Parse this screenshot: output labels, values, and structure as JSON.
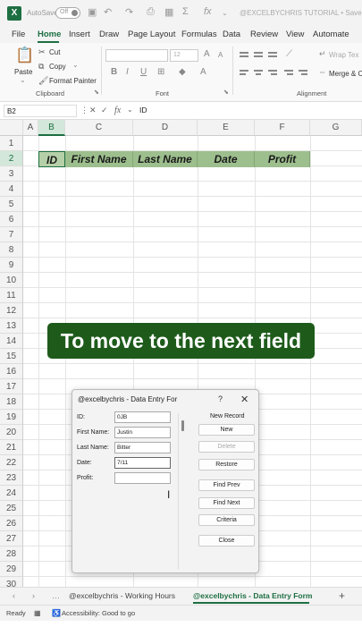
{
  "titlebar": {
    "autosave_label": "AutoSave",
    "toggle_label": "Off",
    "title": "@EXCELBYCHRIS TUTORIAL • Saved",
    "title_chevron": "⌄"
  },
  "menu": {
    "tabs": [
      "File",
      "Home",
      "Insert",
      "Draw",
      "Page Layout",
      "Formulas",
      "Data",
      "Review",
      "View",
      "Automate"
    ],
    "active": "Home"
  },
  "ribbon": {
    "paste_label": "Paste",
    "cut_label": "Cut",
    "copy_label": "Copy",
    "format_painter_label": "Format Painter",
    "clipboard_group": "Clipboard",
    "font_size": "12",
    "font_group": "Font",
    "wrap_text_label": "Wrap Tex",
    "merge_label": "Merge & C",
    "alignment_group": "Alignment",
    "bold": "B",
    "italic": "I",
    "underline": "U"
  },
  "formula_bar": {
    "name_box": "B2",
    "fx": "fx",
    "value": "ID"
  },
  "sheet": {
    "columns": [
      "A",
      "B",
      "C",
      "D",
      "E",
      "F",
      "G"
    ],
    "rows": [
      "1",
      "2",
      "3",
      "4",
      "5",
      "6",
      "7",
      "8",
      "9",
      "10",
      "11",
      "12",
      "13",
      "14",
      "15",
      "16",
      "17",
      "18",
      "19",
      "20",
      "21",
      "22",
      "23",
      "24",
      "25",
      "26",
      "27",
      "28",
      "29",
      "30"
    ],
    "header_cells": [
      "ID",
      "First Name",
      "Last Name",
      "Date",
      "Profit"
    ]
  },
  "overlay": {
    "caption": "To move to the next field"
  },
  "dialog": {
    "title": "@excelbychris - Data Entry For",
    "help": "?",
    "close": "✕",
    "fields": [
      {
        "label": "ID:",
        "value": "0JB"
      },
      {
        "label": "First Name:",
        "value": "Justin"
      },
      {
        "label": "Last Name:",
        "value": "Bitter"
      },
      {
        "label": "Date:",
        "value": "7/11"
      },
      {
        "label": "Profit:",
        "value": ""
      }
    ],
    "record_label": "New Record",
    "buttons": [
      "New",
      "Delete",
      "Restore",
      "Find Prev",
      "Find Next",
      "Criteria",
      "Close"
    ]
  },
  "tabs": {
    "sheet_tabs": [
      "@excelbychris - Working Hours",
      "@excelbychris - Data Entry Form"
    ],
    "active_index": 1,
    "add": "+"
  },
  "status": {
    "ready": "Ready",
    "accessibility": "Accessibility: Good to go"
  },
  "colors": {
    "excel_green": "#1d6f42",
    "header_fill": "#9dbf8e",
    "banner_bg": "#1e5b1b"
  }
}
